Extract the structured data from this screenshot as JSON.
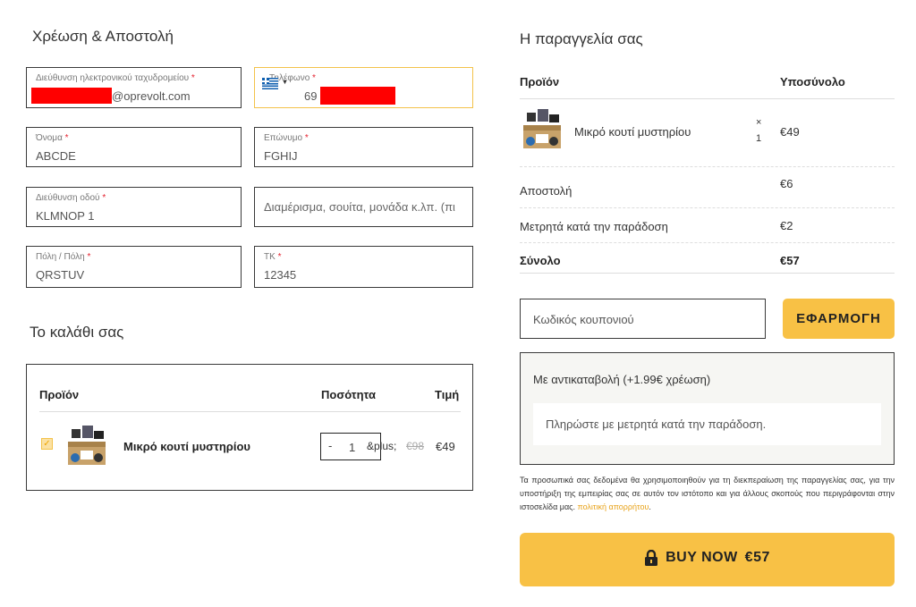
{
  "billing": {
    "heading": "Χρέωση & Αποστολή",
    "email": {
      "label": "Διεύθυνση ηλεκτρονικού ταχυδρομείου",
      "required": "*",
      "value_visible": "@oprevolt.com"
    },
    "phone": {
      "label": "Τηλέφωνο",
      "required": "*",
      "value_visible": "69"
    },
    "first_name": {
      "label": "Όνομα",
      "required": "*",
      "value": "ABCDE"
    },
    "last_name": {
      "label": "Επώνυμο",
      "required": "*",
      "value": "FGHIJ"
    },
    "street": {
      "label": "Διεύθυνση οδού",
      "required": "*",
      "value": "KLMNOP 1"
    },
    "apartment": {
      "placeholder": "Διαμέρισμα, σουίτα, μονάδα κ.λπ. (πι"
    },
    "city": {
      "label": "Πόλη / Πόλη",
      "required": "*",
      "value": "QRSTUV"
    },
    "postcode": {
      "label": "ΤΚ",
      "required": "*",
      "value": "12345"
    }
  },
  "cart": {
    "heading": "Το καλάθι σας",
    "col_product": "Προϊόν",
    "col_qty": "Ποσότητα",
    "col_price": "Τιμή",
    "item": {
      "checked": "✓",
      "name": "Μικρό κουτί μυστηρίου",
      "minus": "-",
      "qty": "1",
      "plus": "&plus;",
      "price_old": "€98",
      "price_new": "€49"
    }
  },
  "order": {
    "heading": "Η παραγγελία σας",
    "col_product": "Προϊόν",
    "col_subtotal": "Υποσύνολο",
    "item": {
      "name": "Μικρό κουτί μυστηρίου",
      "times": "×",
      "qty": "1",
      "price": "€49"
    },
    "shipping": {
      "label": "Αποστολή",
      "value": "€6"
    },
    "cod_fee": {
      "label": "Μετρητά κατά την παράδοση",
      "value": "€2"
    },
    "total": {
      "label": "Σύνολο",
      "value": "€57"
    }
  },
  "coupon": {
    "placeholder": "Κωδικός κουπονιού",
    "apply_label": "ΕΦΑΡΜΟΓΗ"
  },
  "payment": {
    "method_label": "Με αντικαταβολή (+1.99€ χρέωση)",
    "description": "Πληρώστε με μετρητά κατά την παράδοση."
  },
  "privacy": {
    "text": "Τα προσωπικά σας δεδομένα θα χρησιμοποιηθούν για τη διεκπεραίωση της παραγγελίας σας, για την υποστήριξη της εμπειρίας σας σε αυτόν τον ιστότοπο και για άλλους σκοπούς που περιγράφονται στην ιστοσελίδα μας.",
    "link": "πολιτική απορρήτου",
    "end": "."
  },
  "buy": {
    "label": "BUY NOW",
    "amount": "€57"
  },
  "colors": {
    "accent": "#f8c145",
    "focus_border": "#f3c24a",
    "required": "#e4222f",
    "link": "#e8a31b",
    "redaction": "#ff0000"
  },
  "icons": {
    "lock": "lock-icon",
    "flag": "greece-flag-icon",
    "checkbox": "check-icon"
  }
}
